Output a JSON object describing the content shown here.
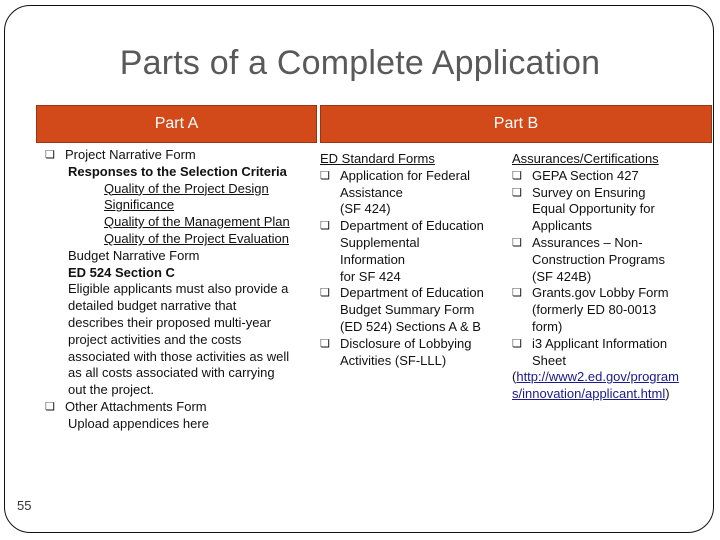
{
  "slide": {
    "title": "Parts of a Complete Application",
    "number": "55",
    "colors": {
      "header_bar": "#D24A1A",
      "header_border": "#9C3412",
      "title": "#595959"
    }
  },
  "part_a": {
    "header": "Part A",
    "items": {
      "project_narrative": {
        "label": "Project Narrative Form",
        "subheading": "Responses to the Selection Criteria",
        "criteria": [
          "Quality of the Project Design",
          "Significance",
          "Quality of the Management Plan",
          "Quality of the Project Evaluation"
        ],
        "budget_form": "Budget Narrative Form",
        "budget_section": "ED 524  Section C",
        "budget_lines": [
          "Eligible applicants must also provide a",
          "detailed budget narrative that",
          "describes their proposed multi-year",
          "project activities and the costs",
          "associated with those activities as well",
          "as all costs associated with carrying",
          "out the project."
        ]
      },
      "other_attachments": {
        "label": "Other Attachments Form",
        "note": "Upload appendices here"
      }
    }
  },
  "part_b": {
    "header": "Part B",
    "standard_forms": {
      "heading": "ED Standard Forms",
      "items": [
        {
          "lines": [
            "Application for Federal",
            "Assistance",
            "(SF 424)"
          ]
        },
        {
          "lines": [
            "Department of Education",
            "Supplemental",
            "Information",
            "for SF 424"
          ]
        },
        {
          "lines": [
            "Department of Education",
            "Budget Summary Form",
            "(ED 524) Sections A & B"
          ]
        },
        {
          "lines": [
            "Disclosure of Lobbying",
            "Activities (SF-LLL)"
          ]
        }
      ]
    },
    "assurances": {
      "heading": "Assurances/Certifications",
      "items": [
        {
          "lines": [
            "GEPA Section 427"
          ]
        },
        {
          "lines": [
            "Survey on Ensuring",
            "Equal Opportunity for",
            "Applicants"
          ]
        },
        {
          "lines": [
            "Assurances – Non-",
            "Construction Programs",
            "(SF 424B)"
          ]
        },
        {
          "lines": [
            "Grants.gov Lobby Form",
            "(formerly ED 80-0013",
            "form)"
          ]
        },
        {
          "lines": [
            "i3 Applicant Information",
            "Sheet"
          ]
        }
      ],
      "link_open": "(",
      "link_line1": "http://www2.ed.gov/program",
      "link_line2": "s/innovation/applicant.html",
      "link_close": ")"
    }
  }
}
